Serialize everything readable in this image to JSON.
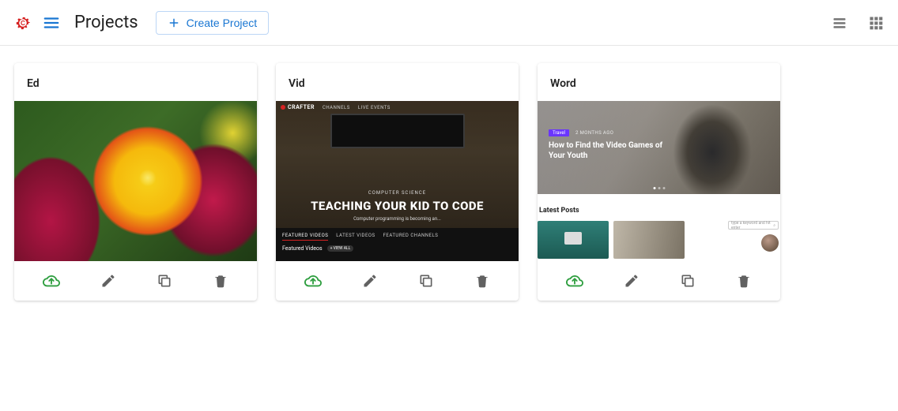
{
  "header": {
    "page_title": "Projects",
    "create_label": "Create Project"
  },
  "projects": [
    {
      "title": "Ed"
    },
    {
      "title": "Vid"
    },
    {
      "title": "Word"
    }
  ],
  "vid_preview": {
    "brand": "CRAFTER",
    "nav": [
      "CHANNELS",
      "LIVE EVENTS"
    ],
    "category": "COMPUTER SCIENCE",
    "headline": "TEACHING YOUR KID TO CODE",
    "subline": "Computer programming is becoming an...",
    "tabs": [
      "FEATURED VIDEOS",
      "LATEST VIDEOS",
      "FEATURED CHANNELS"
    ],
    "featured_label": "Featured Videos",
    "view_all": "+ VIEW ALL"
  },
  "word_preview": {
    "badge": "Travel",
    "meta": "2 MONTHS AGO",
    "hero_title": "How to Find the Video Games of Your Youth",
    "section": "Latest Posts",
    "search_placeholder": "type a keyword and hit enter"
  }
}
